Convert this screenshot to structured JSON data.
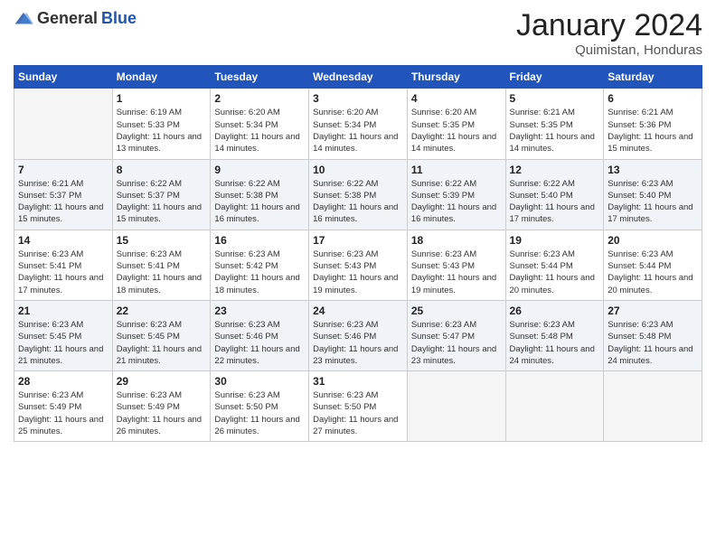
{
  "header": {
    "logo_general": "General",
    "logo_blue": "Blue",
    "month": "January 2024",
    "location": "Quimistan, Honduras"
  },
  "weekdays": [
    "Sunday",
    "Monday",
    "Tuesday",
    "Wednesday",
    "Thursday",
    "Friday",
    "Saturday"
  ],
  "weeks": [
    [
      {
        "day": "",
        "sunrise": "",
        "sunset": "",
        "daylight": ""
      },
      {
        "day": "1",
        "sunrise": "Sunrise: 6:19 AM",
        "sunset": "Sunset: 5:33 PM",
        "daylight": "Daylight: 11 hours and 13 minutes."
      },
      {
        "day": "2",
        "sunrise": "Sunrise: 6:20 AM",
        "sunset": "Sunset: 5:34 PM",
        "daylight": "Daylight: 11 hours and 14 minutes."
      },
      {
        "day": "3",
        "sunrise": "Sunrise: 6:20 AM",
        "sunset": "Sunset: 5:34 PM",
        "daylight": "Daylight: 11 hours and 14 minutes."
      },
      {
        "day": "4",
        "sunrise": "Sunrise: 6:20 AM",
        "sunset": "Sunset: 5:35 PM",
        "daylight": "Daylight: 11 hours and 14 minutes."
      },
      {
        "day": "5",
        "sunrise": "Sunrise: 6:21 AM",
        "sunset": "Sunset: 5:35 PM",
        "daylight": "Daylight: 11 hours and 14 minutes."
      },
      {
        "day": "6",
        "sunrise": "Sunrise: 6:21 AM",
        "sunset": "Sunset: 5:36 PM",
        "daylight": "Daylight: 11 hours and 15 minutes."
      }
    ],
    [
      {
        "day": "7",
        "sunrise": "Sunrise: 6:21 AM",
        "sunset": "Sunset: 5:37 PM",
        "daylight": "Daylight: 11 hours and 15 minutes."
      },
      {
        "day": "8",
        "sunrise": "Sunrise: 6:22 AM",
        "sunset": "Sunset: 5:37 PM",
        "daylight": "Daylight: 11 hours and 15 minutes."
      },
      {
        "day": "9",
        "sunrise": "Sunrise: 6:22 AM",
        "sunset": "Sunset: 5:38 PM",
        "daylight": "Daylight: 11 hours and 16 minutes."
      },
      {
        "day": "10",
        "sunrise": "Sunrise: 6:22 AM",
        "sunset": "Sunset: 5:38 PM",
        "daylight": "Daylight: 11 hours and 16 minutes."
      },
      {
        "day": "11",
        "sunrise": "Sunrise: 6:22 AM",
        "sunset": "Sunset: 5:39 PM",
        "daylight": "Daylight: 11 hours and 16 minutes."
      },
      {
        "day": "12",
        "sunrise": "Sunrise: 6:22 AM",
        "sunset": "Sunset: 5:40 PM",
        "daylight": "Daylight: 11 hours and 17 minutes."
      },
      {
        "day": "13",
        "sunrise": "Sunrise: 6:23 AM",
        "sunset": "Sunset: 5:40 PM",
        "daylight": "Daylight: 11 hours and 17 minutes."
      }
    ],
    [
      {
        "day": "14",
        "sunrise": "Sunrise: 6:23 AM",
        "sunset": "Sunset: 5:41 PM",
        "daylight": "Daylight: 11 hours and 17 minutes."
      },
      {
        "day": "15",
        "sunrise": "Sunrise: 6:23 AM",
        "sunset": "Sunset: 5:41 PM",
        "daylight": "Daylight: 11 hours and 18 minutes."
      },
      {
        "day": "16",
        "sunrise": "Sunrise: 6:23 AM",
        "sunset": "Sunset: 5:42 PM",
        "daylight": "Daylight: 11 hours and 18 minutes."
      },
      {
        "day": "17",
        "sunrise": "Sunrise: 6:23 AM",
        "sunset": "Sunset: 5:43 PM",
        "daylight": "Daylight: 11 hours and 19 minutes."
      },
      {
        "day": "18",
        "sunrise": "Sunrise: 6:23 AM",
        "sunset": "Sunset: 5:43 PM",
        "daylight": "Daylight: 11 hours and 19 minutes."
      },
      {
        "day": "19",
        "sunrise": "Sunrise: 6:23 AM",
        "sunset": "Sunset: 5:44 PM",
        "daylight": "Daylight: 11 hours and 20 minutes."
      },
      {
        "day": "20",
        "sunrise": "Sunrise: 6:23 AM",
        "sunset": "Sunset: 5:44 PM",
        "daylight": "Daylight: 11 hours and 20 minutes."
      }
    ],
    [
      {
        "day": "21",
        "sunrise": "Sunrise: 6:23 AM",
        "sunset": "Sunset: 5:45 PM",
        "daylight": "Daylight: 11 hours and 21 minutes."
      },
      {
        "day": "22",
        "sunrise": "Sunrise: 6:23 AM",
        "sunset": "Sunset: 5:45 PM",
        "daylight": "Daylight: 11 hours and 21 minutes."
      },
      {
        "day": "23",
        "sunrise": "Sunrise: 6:23 AM",
        "sunset": "Sunset: 5:46 PM",
        "daylight": "Daylight: 11 hours and 22 minutes."
      },
      {
        "day": "24",
        "sunrise": "Sunrise: 6:23 AM",
        "sunset": "Sunset: 5:46 PM",
        "daylight": "Daylight: 11 hours and 23 minutes."
      },
      {
        "day": "25",
        "sunrise": "Sunrise: 6:23 AM",
        "sunset": "Sunset: 5:47 PM",
        "daylight": "Daylight: 11 hours and 23 minutes."
      },
      {
        "day": "26",
        "sunrise": "Sunrise: 6:23 AM",
        "sunset": "Sunset: 5:48 PM",
        "daylight": "Daylight: 11 hours and 24 minutes."
      },
      {
        "day": "27",
        "sunrise": "Sunrise: 6:23 AM",
        "sunset": "Sunset: 5:48 PM",
        "daylight": "Daylight: 11 hours and 24 minutes."
      }
    ],
    [
      {
        "day": "28",
        "sunrise": "Sunrise: 6:23 AM",
        "sunset": "Sunset: 5:49 PM",
        "daylight": "Daylight: 11 hours and 25 minutes."
      },
      {
        "day": "29",
        "sunrise": "Sunrise: 6:23 AM",
        "sunset": "Sunset: 5:49 PM",
        "daylight": "Daylight: 11 hours and 26 minutes."
      },
      {
        "day": "30",
        "sunrise": "Sunrise: 6:23 AM",
        "sunset": "Sunset: 5:50 PM",
        "daylight": "Daylight: 11 hours and 26 minutes."
      },
      {
        "day": "31",
        "sunrise": "Sunrise: 6:23 AM",
        "sunset": "Sunset: 5:50 PM",
        "daylight": "Daylight: 11 hours and 27 minutes."
      },
      {
        "day": "",
        "sunrise": "",
        "sunset": "",
        "daylight": ""
      },
      {
        "day": "",
        "sunrise": "",
        "sunset": "",
        "daylight": ""
      },
      {
        "day": "",
        "sunrise": "",
        "sunset": "",
        "daylight": ""
      }
    ]
  ]
}
